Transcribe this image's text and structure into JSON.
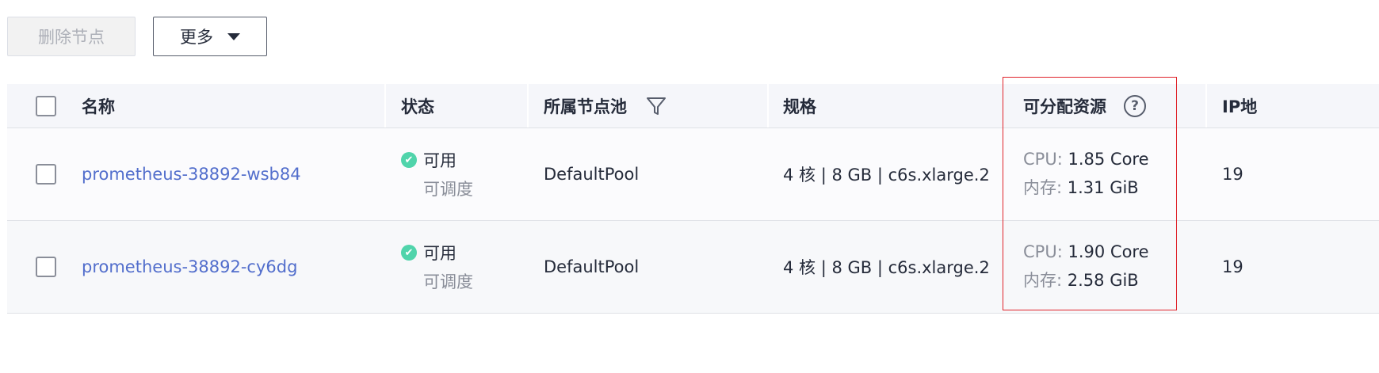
{
  "toolbar": {
    "delete_label": "删除节点",
    "more_label": "更多"
  },
  "table": {
    "headers": {
      "name": "名称",
      "status": "状态",
      "pool": "所属节点池",
      "spec": "规格",
      "allocatable": "可分配资源",
      "ip": "IP地"
    },
    "rows": [
      {
        "name": "prometheus-38892-wsb84",
        "status": "可用",
        "sub_status": "可调度",
        "pool": "DefaultPool",
        "spec": "4 核 | 8 GB | c6s.xlarge.2",
        "cpu_key": "CPU:",
        "cpu_val": "1.85 Core",
        "mem_key": "内存:",
        "mem_val": "1.31 GiB",
        "ip": "19"
      },
      {
        "name": "prometheus-38892-cy6dg",
        "status": "可用",
        "sub_status": "可调度",
        "pool": "DefaultPool",
        "spec": "4 核 | 8 GB | c6s.xlarge.2",
        "cpu_key": "CPU:",
        "cpu_val": "1.90 Core",
        "mem_key": "内存:",
        "mem_val": "2.58 GiB",
        "ip": "19"
      }
    ]
  },
  "colors": {
    "link": "#526ecc",
    "status_ok": "#50d4ab",
    "highlight_border": "#e0242b",
    "header_bg": "#f5f6fa"
  }
}
